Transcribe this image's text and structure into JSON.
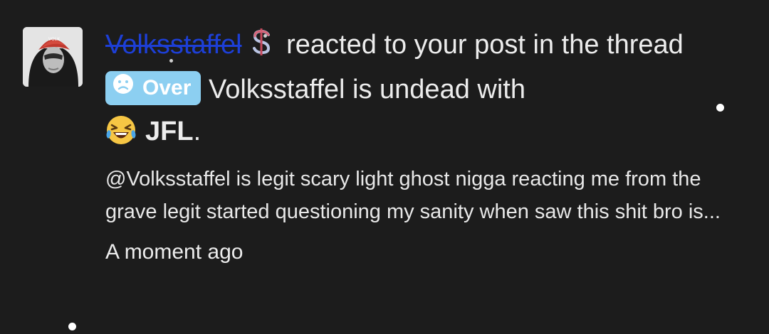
{
  "notification": {
    "username": "Volksstaffel",
    "username_icon": "dollar-sign-icon",
    "text_1": "reacted to your post in the thread",
    "prefix_label": "Over",
    "prefix_icon": "sad-face-icon",
    "thread_title": "Volksstaffel is undead with",
    "reaction_icon": "laughing-tears-emoji",
    "reaction_name": "JFL",
    "period": ".",
    "snippet": "@Volksstaffel is legit scary light ghost nigga reacting me from the grave legit started questioning my sanity when saw this shit bro is...",
    "time": "A moment ago"
  },
  "colors": {
    "background": "#1c1c1c",
    "username": "#1d3fd6",
    "badge": "#8ccff1",
    "text": "#ececec"
  }
}
